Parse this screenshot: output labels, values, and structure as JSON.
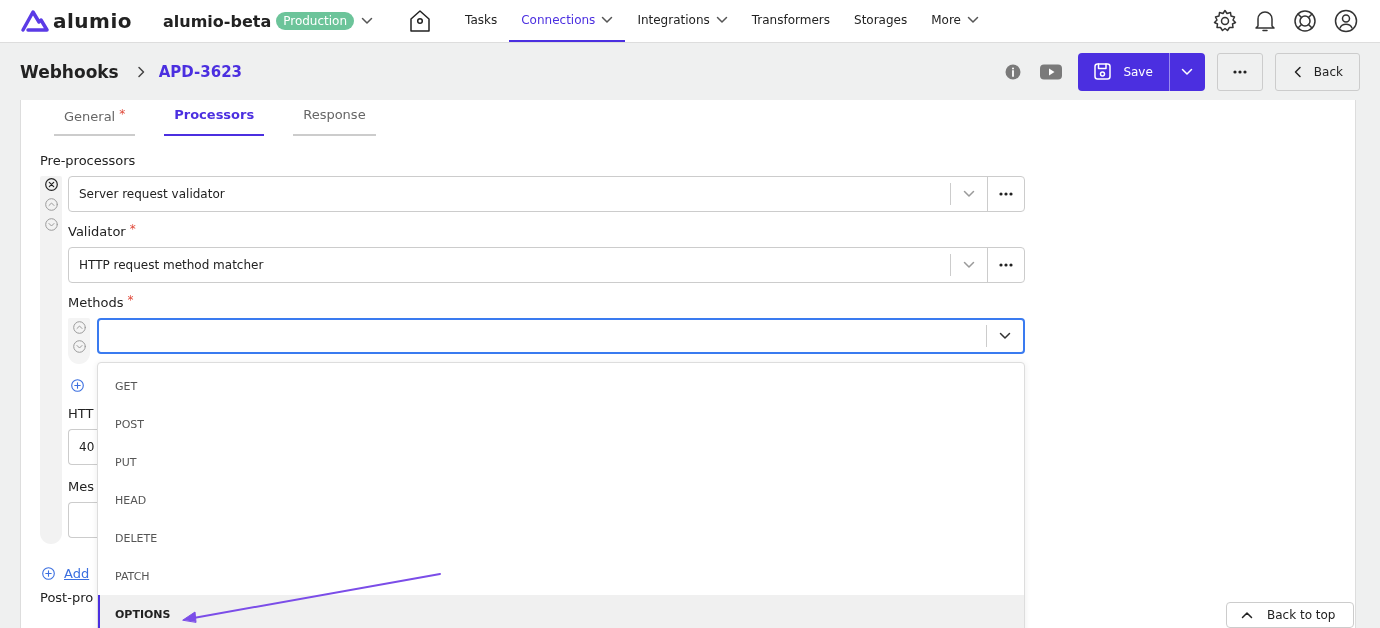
{
  "nav": {
    "logo": "alumio",
    "workspace": "alumio-beta",
    "environment": "Production",
    "items": [
      {
        "label": "Tasks",
        "selected": false,
        "menu": false
      },
      {
        "label": "Connections",
        "selected": true,
        "menu": true
      },
      {
        "label": "Integrations",
        "selected": false,
        "menu": true
      },
      {
        "label": "Transformers",
        "selected": false,
        "menu": false
      },
      {
        "label": "Storages",
        "selected": false,
        "menu": false
      },
      {
        "label": "More",
        "selected": false,
        "menu": true
      }
    ]
  },
  "header": {
    "breadcrumb": [
      "Webhooks",
      "APD-3623"
    ],
    "save": "Save",
    "back": "Back"
  },
  "tabs": [
    {
      "label": "General",
      "required_mark": "*",
      "selected": false
    },
    {
      "label": "Processors",
      "selected": true
    },
    {
      "label": "Response",
      "selected": false
    }
  ],
  "pre_processors": {
    "label": "Pre-processors",
    "processor": "Server request validator",
    "validator_label": "Validator",
    "validator_required_mark": "*",
    "validator": "HTTP request method matcher",
    "methods_label": "Methods",
    "methods_required_mark": "*",
    "status_label": "HTT",
    "status_value": "40",
    "message_label": "Mes"
  },
  "add_pre_link": "Add",
  "post_label": "Post-pro",
  "methods_dropdown": {
    "options": [
      {
        "label": "GET",
        "highlighted": false
      },
      {
        "label": "POST",
        "highlighted": false
      },
      {
        "label": "PUT",
        "highlighted": false
      },
      {
        "label": "HEAD",
        "highlighted": false
      },
      {
        "label": "DELETE",
        "highlighted": false
      },
      {
        "label": "PATCH",
        "highlighted": false
      },
      {
        "label": "OPTIONS",
        "highlighted": true
      }
    ]
  },
  "back_to_top": "Back to top"
}
